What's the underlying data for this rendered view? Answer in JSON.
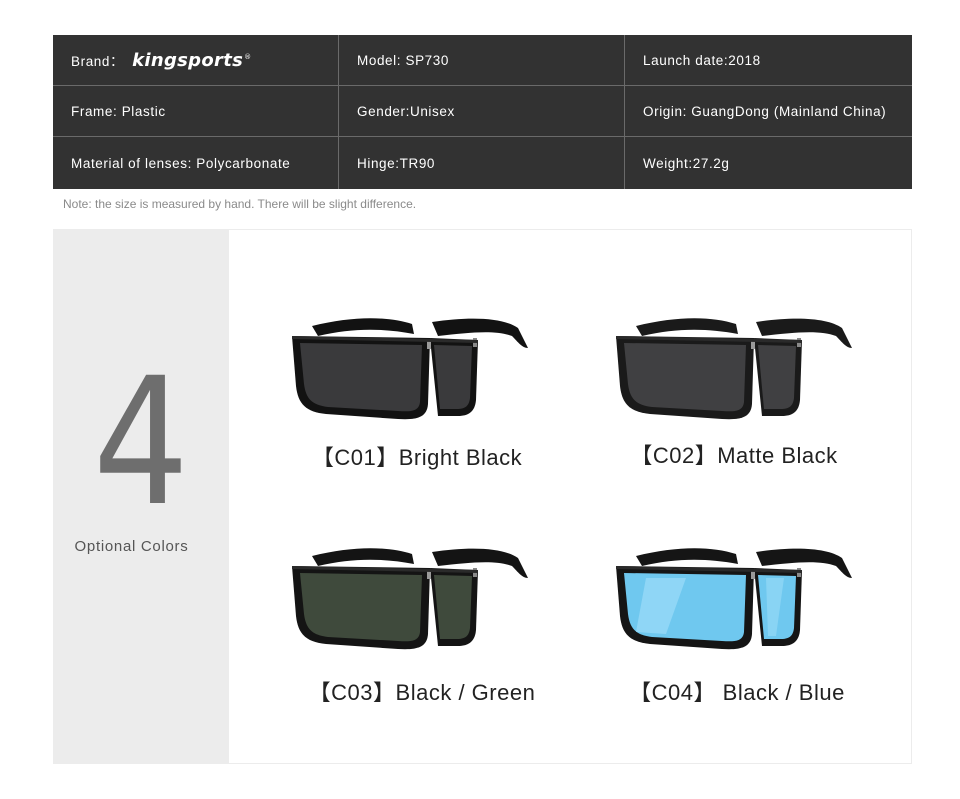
{
  "specs": {
    "brand_label": "Brand：",
    "brand_logo": "kingsports",
    "brand_mark": "®",
    "model": "Model: SP730",
    "launch_date": "Launch date:2018",
    "frame": "Frame: Plastic",
    "gender": "Gender:Unisex",
    "origin": "Origin: GuangDong (Mainland China)",
    "lenses": "Material of lenses: Polycarbonate",
    "hinge": "Hinge:TR90",
    "weight": "Weight:27.2g"
  },
  "note": "Note: the size is measured by hand. There will be slight difference.",
  "colors_section": {
    "count": "4",
    "caption": "Optional Colors"
  },
  "products": [
    {
      "label": "【C01】Bright Black",
      "lens_color": "#3a3a3c",
      "frame_color": "#121212"
    },
    {
      "label": "【C02】Matte Black",
      "lens_color": "#404042",
      "frame_color": "#1a1a1a"
    },
    {
      "label": "【C03】Black / Green",
      "lens_color": "#3f4a3c",
      "frame_color": "#141414"
    },
    {
      "label": "【C04】 Black / Blue",
      "lens_color": "#6fc8ef",
      "frame_color": "#151515"
    }
  ]
}
